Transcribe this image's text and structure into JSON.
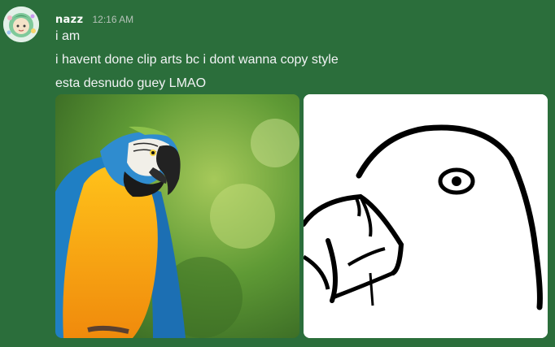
{
  "message": {
    "username": "nazz",
    "timestamp": "12:16 AM",
    "lines": [
      "i am",
      "i havent done clip arts bc i dont wanna copy style",
      "esta desnudo guey LMAO"
    ]
  },
  "attachments": [
    {
      "kind": "photo",
      "subject": "macaw-photo"
    },
    {
      "kind": "drawing",
      "subject": "parrot-sketch"
    }
  ],
  "colors": {
    "background": "#2b6e3b",
    "text": "#f2f3f5",
    "timestamp": "#b5c2b8"
  }
}
